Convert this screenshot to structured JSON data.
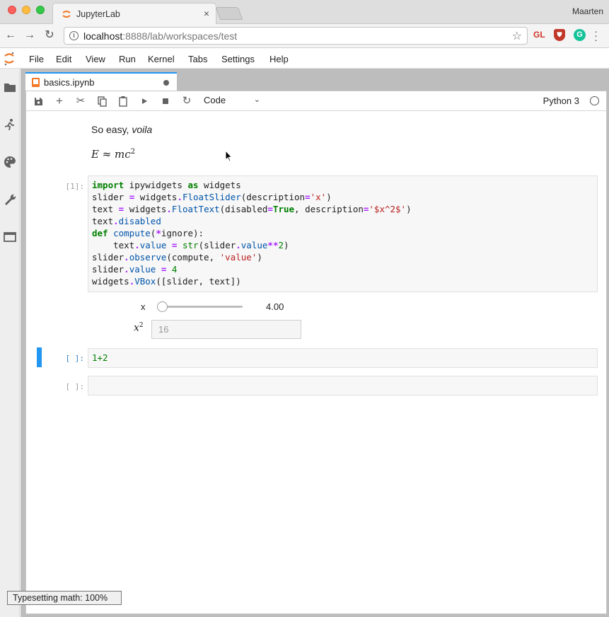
{
  "browser": {
    "tab_title": "JupyterLab",
    "profile_name": "Maarten",
    "url_host": "localhost",
    "url_rest": ":8888/lab/workspaces/test",
    "extensions": {
      "gl": "GL",
      "grammarly": "G"
    }
  },
  "menubar": {
    "items": [
      "File",
      "Edit",
      "View",
      "Run",
      "Kernel",
      "Tabs",
      "Settings",
      "Help"
    ]
  },
  "sidebar": {
    "icons": [
      "folder-icon",
      "running-icon",
      "palette-icon",
      "wrench-icon",
      "tabs-icon"
    ]
  },
  "document": {
    "tab_label": "basics.ipynb",
    "dirty": true
  },
  "toolbar": {
    "cell_type": "Code",
    "kernel_name": "Python 3"
  },
  "notebook": {
    "markdown_text_plain": "So easy, ",
    "markdown_text_italic": "voila",
    "markdown_math": "E ≈ mc",
    "markdown_math_sup": "2",
    "cell1_prompt": "[1]:",
    "cell1_lines": [
      "import ipywidgets as widgets",
      "slider = widgets.FloatSlider(description='x')",
      "text = widgets.FloatText(disabled=True, description='$x^2$')",
      "text.disabled",
      "def compute(*ignore):",
      "    text.value = str(slider.value**2)",
      "slider.observe(compute, 'value')",
      "slider.value = 4",
      "widgets.VBox([slider, text])"
    ],
    "slider_label": "x",
    "slider_value": "4.00",
    "slider_fraction": 0.04,
    "floattext_label": "x",
    "floattext_label_sup": "2",
    "floattext_value": "16",
    "cell2_prompt": "[ ]:",
    "cell2_code": "1+2",
    "cell3_prompt": "[ ]:"
  },
  "status": {
    "tooltip": "Typesetting math: 100%"
  },
  "colors": {
    "accent": "#2196f3",
    "jupyter_orange": "#f37726",
    "keyword": "#008000",
    "string": "#ba2121",
    "operator": "#aa22ff"
  }
}
